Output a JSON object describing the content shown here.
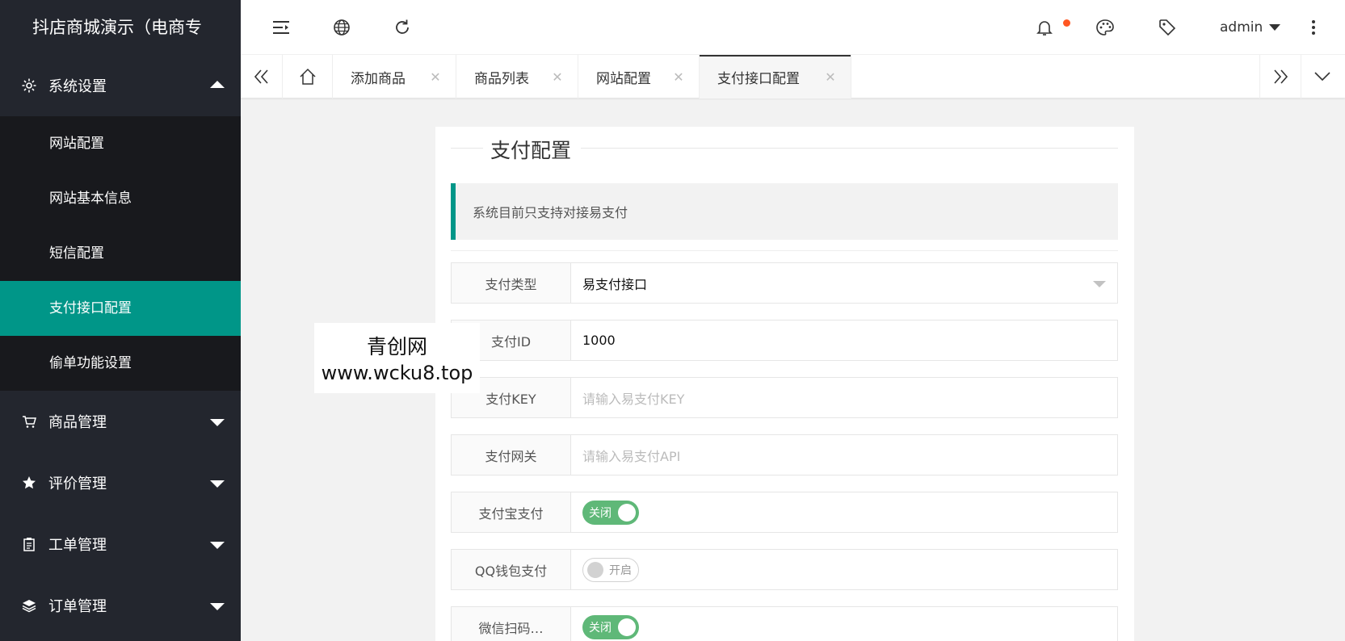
{
  "app": {
    "title": "抖店商城演示（电商专"
  },
  "sidebar": {
    "groups": [
      {
        "label": "系统设置",
        "icon": "gear-icon",
        "expanded": true,
        "items": [
          {
            "label": "网站配置"
          },
          {
            "label": "网站基本信息"
          },
          {
            "label": "短信配置"
          },
          {
            "label": "支付接口配置",
            "active": true
          },
          {
            "label": "偷单功能设置"
          }
        ]
      },
      {
        "label": "商品管理",
        "icon": "cart-icon"
      },
      {
        "label": "评价管理",
        "icon": "star-icon"
      },
      {
        "label": "工单管理",
        "icon": "clipboard-icon"
      },
      {
        "label": "订单管理",
        "icon": "layers-icon"
      }
    ]
  },
  "header": {
    "user": "admin",
    "icons": [
      "menu-fold-icon",
      "globe-icon",
      "refresh-icon",
      "bell-icon",
      "theme-icon",
      "tag-icon",
      "more-vertical-icon"
    ]
  },
  "tabs": [
    {
      "label": "添加商品"
    },
    {
      "label": "商品列表"
    },
    {
      "label": "网站配置"
    },
    {
      "label": "支付接口配置",
      "active": true
    }
  ],
  "form": {
    "legend": "支付配置",
    "notice": "系统目前只支持对接易支付",
    "rows": [
      {
        "label": "支付类型",
        "value": "易支付接口",
        "type": "select"
      },
      {
        "label": "支付ID",
        "value": "1000",
        "type": "text"
      },
      {
        "label": "支付KEY",
        "placeholder": "请输入易支付KEY",
        "type": "text"
      },
      {
        "label": "支付网关",
        "placeholder": "请输入易支付API",
        "type": "text"
      },
      {
        "label": "支付宝支付",
        "switch_text": "关闭",
        "switch_on": true,
        "type": "switch"
      },
      {
        "label": "QQ钱包支付",
        "switch_text": "开启",
        "switch_on": false,
        "type": "switch"
      },
      {
        "label": "微信扫码…",
        "switch_text": "关闭",
        "switch_on": true,
        "type": "switch"
      }
    ]
  },
  "watermark": {
    "line1": "青创网",
    "line2": "www.wcku8.top"
  },
  "colors": {
    "sidebar_bg": "#23262e",
    "submenu_bg": "#18191d",
    "accent": "#009688",
    "switch_on": "#5fb878",
    "notify_dot": "#ff5722"
  }
}
